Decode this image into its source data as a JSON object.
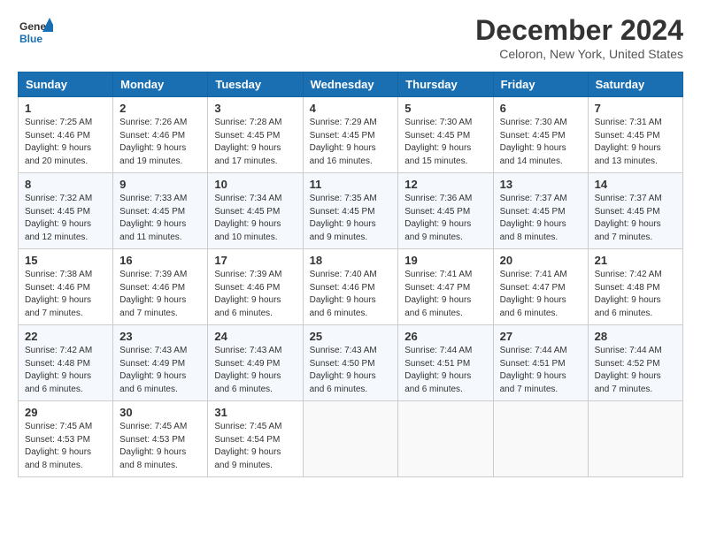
{
  "header": {
    "logo_general": "General",
    "logo_blue": "Blue",
    "main_title": "December 2024",
    "subtitle": "Celoron, New York, United States"
  },
  "calendar": {
    "days_of_week": [
      "Sunday",
      "Monday",
      "Tuesday",
      "Wednesday",
      "Thursday",
      "Friday",
      "Saturday"
    ],
    "weeks": [
      [
        {
          "day": "1",
          "sunrise": "Sunrise: 7:25 AM",
          "sunset": "Sunset: 4:46 PM",
          "daylight": "Daylight: 9 hours and 20 minutes."
        },
        {
          "day": "2",
          "sunrise": "Sunrise: 7:26 AM",
          "sunset": "Sunset: 4:46 PM",
          "daylight": "Daylight: 9 hours and 19 minutes."
        },
        {
          "day": "3",
          "sunrise": "Sunrise: 7:28 AM",
          "sunset": "Sunset: 4:45 PM",
          "daylight": "Daylight: 9 hours and 17 minutes."
        },
        {
          "day": "4",
          "sunrise": "Sunrise: 7:29 AM",
          "sunset": "Sunset: 4:45 PM",
          "daylight": "Daylight: 9 hours and 16 minutes."
        },
        {
          "day": "5",
          "sunrise": "Sunrise: 7:30 AM",
          "sunset": "Sunset: 4:45 PM",
          "daylight": "Daylight: 9 hours and 15 minutes."
        },
        {
          "day": "6",
          "sunrise": "Sunrise: 7:30 AM",
          "sunset": "Sunset: 4:45 PM",
          "daylight": "Daylight: 9 hours and 14 minutes."
        },
        {
          "day": "7",
          "sunrise": "Sunrise: 7:31 AM",
          "sunset": "Sunset: 4:45 PM",
          "daylight": "Daylight: 9 hours and 13 minutes."
        }
      ],
      [
        {
          "day": "8",
          "sunrise": "Sunrise: 7:32 AM",
          "sunset": "Sunset: 4:45 PM",
          "daylight": "Daylight: 9 hours and 12 minutes."
        },
        {
          "day": "9",
          "sunrise": "Sunrise: 7:33 AM",
          "sunset": "Sunset: 4:45 PM",
          "daylight": "Daylight: 9 hours and 11 minutes."
        },
        {
          "day": "10",
          "sunrise": "Sunrise: 7:34 AM",
          "sunset": "Sunset: 4:45 PM",
          "daylight": "Daylight: 9 hours and 10 minutes."
        },
        {
          "day": "11",
          "sunrise": "Sunrise: 7:35 AM",
          "sunset": "Sunset: 4:45 PM",
          "daylight": "Daylight: 9 hours and 9 minutes."
        },
        {
          "day": "12",
          "sunrise": "Sunrise: 7:36 AM",
          "sunset": "Sunset: 4:45 PM",
          "daylight": "Daylight: 9 hours and 9 minutes."
        },
        {
          "day": "13",
          "sunrise": "Sunrise: 7:37 AM",
          "sunset": "Sunset: 4:45 PM",
          "daylight": "Daylight: 9 hours and 8 minutes."
        },
        {
          "day": "14",
          "sunrise": "Sunrise: 7:37 AM",
          "sunset": "Sunset: 4:45 PM",
          "daylight": "Daylight: 9 hours and 7 minutes."
        }
      ],
      [
        {
          "day": "15",
          "sunrise": "Sunrise: 7:38 AM",
          "sunset": "Sunset: 4:46 PM",
          "daylight": "Daylight: 9 hours and 7 minutes."
        },
        {
          "day": "16",
          "sunrise": "Sunrise: 7:39 AM",
          "sunset": "Sunset: 4:46 PM",
          "daylight": "Daylight: 9 hours and 7 minutes."
        },
        {
          "day": "17",
          "sunrise": "Sunrise: 7:39 AM",
          "sunset": "Sunset: 4:46 PM",
          "daylight": "Daylight: 9 hours and 6 minutes."
        },
        {
          "day": "18",
          "sunrise": "Sunrise: 7:40 AM",
          "sunset": "Sunset: 4:46 PM",
          "daylight": "Daylight: 9 hours and 6 minutes."
        },
        {
          "day": "19",
          "sunrise": "Sunrise: 7:41 AM",
          "sunset": "Sunset: 4:47 PM",
          "daylight": "Daylight: 9 hours and 6 minutes."
        },
        {
          "day": "20",
          "sunrise": "Sunrise: 7:41 AM",
          "sunset": "Sunset: 4:47 PM",
          "daylight": "Daylight: 9 hours and 6 minutes."
        },
        {
          "day": "21",
          "sunrise": "Sunrise: 7:42 AM",
          "sunset": "Sunset: 4:48 PM",
          "daylight": "Daylight: 9 hours and 6 minutes."
        }
      ],
      [
        {
          "day": "22",
          "sunrise": "Sunrise: 7:42 AM",
          "sunset": "Sunset: 4:48 PM",
          "daylight": "Daylight: 9 hours and 6 minutes."
        },
        {
          "day": "23",
          "sunrise": "Sunrise: 7:43 AM",
          "sunset": "Sunset: 4:49 PM",
          "daylight": "Daylight: 9 hours and 6 minutes."
        },
        {
          "day": "24",
          "sunrise": "Sunrise: 7:43 AM",
          "sunset": "Sunset: 4:49 PM",
          "daylight": "Daylight: 9 hours and 6 minutes."
        },
        {
          "day": "25",
          "sunrise": "Sunrise: 7:43 AM",
          "sunset": "Sunset: 4:50 PM",
          "daylight": "Daylight: 9 hours and 6 minutes."
        },
        {
          "day": "26",
          "sunrise": "Sunrise: 7:44 AM",
          "sunset": "Sunset: 4:51 PM",
          "daylight": "Daylight: 9 hours and 6 minutes."
        },
        {
          "day": "27",
          "sunrise": "Sunrise: 7:44 AM",
          "sunset": "Sunset: 4:51 PM",
          "daylight": "Daylight: 9 hours and 7 minutes."
        },
        {
          "day": "28",
          "sunrise": "Sunrise: 7:44 AM",
          "sunset": "Sunset: 4:52 PM",
          "daylight": "Daylight: 9 hours and 7 minutes."
        }
      ],
      [
        {
          "day": "29",
          "sunrise": "Sunrise: 7:45 AM",
          "sunset": "Sunset: 4:53 PM",
          "daylight": "Daylight: 9 hours and 8 minutes."
        },
        {
          "day": "30",
          "sunrise": "Sunrise: 7:45 AM",
          "sunset": "Sunset: 4:53 PM",
          "daylight": "Daylight: 9 hours and 8 minutes."
        },
        {
          "day": "31",
          "sunrise": "Sunrise: 7:45 AM",
          "sunset": "Sunset: 4:54 PM",
          "daylight": "Daylight: 9 hours and 9 minutes."
        },
        null,
        null,
        null,
        null
      ]
    ]
  }
}
